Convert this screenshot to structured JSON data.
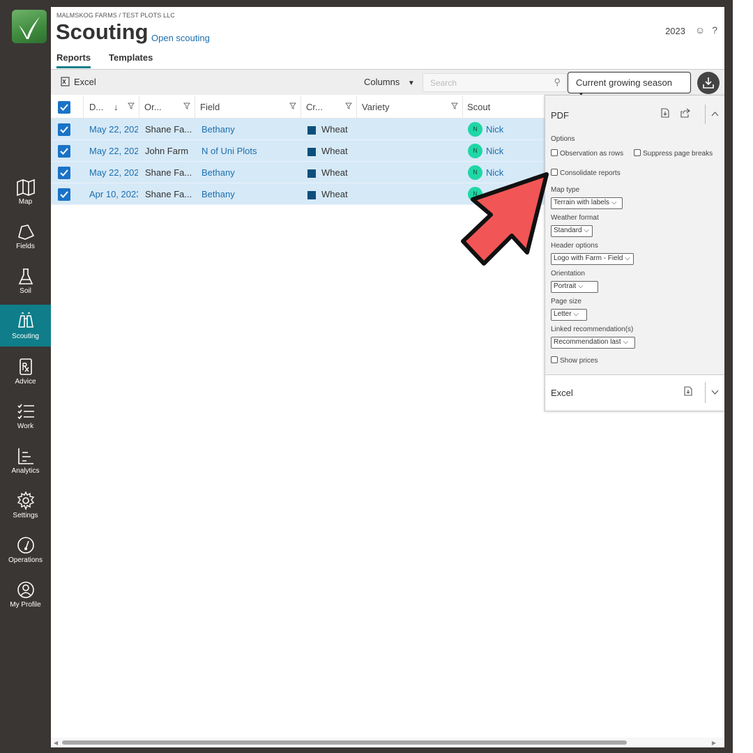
{
  "sidebar": {
    "items": [
      {
        "label": "Map",
        "icon": "map-icon"
      },
      {
        "label": "Fields",
        "icon": "fields-icon"
      },
      {
        "label": "Soil",
        "icon": "flask-icon"
      },
      {
        "label": "Scouting",
        "icon": "binoculars-icon",
        "active": true
      },
      {
        "label": "Advice",
        "icon": "prescription-icon"
      },
      {
        "label": "Work",
        "icon": "checklist-icon"
      },
      {
        "label": "Analytics",
        "icon": "analytics-icon"
      },
      {
        "label": "Settings",
        "icon": "gear-icon"
      },
      {
        "label": "Operations",
        "icon": "gauge-icon"
      },
      {
        "label": "My Profile",
        "icon": "profile-icon"
      }
    ]
  },
  "header": {
    "breadcrumb": "MALMSKOG FARMS / TEST PLOTS LLC",
    "title": "Scouting",
    "open_link": "Open scouting",
    "year": "2023",
    "tabs": [
      {
        "label": "Reports",
        "active": true
      },
      {
        "label": "Templates"
      }
    ]
  },
  "toolbar": {
    "excel_label": "Excel",
    "columns_label": "Columns",
    "search_placeholder": "Search",
    "season_label": "Current growing season"
  },
  "table": {
    "columns": [
      "D...",
      "Or...",
      "Field",
      "Cr...",
      "Variety",
      "Scout"
    ],
    "rows": [
      {
        "date": "May 22, 202",
        "org": "Shane Fa...",
        "field": "Bethany",
        "crop": "Wheat",
        "variety": "",
        "scout_initial": "N",
        "scout": "Nick"
      },
      {
        "date": "May 22, 202",
        "org": "John Farm",
        "field": "N of Uni Plots",
        "crop": "Wheat",
        "variety": "",
        "scout_initial": "N",
        "scout": "Nick"
      },
      {
        "date": "May 22, 202",
        "org": "Shane Fa...",
        "field": "Bethany",
        "crop": "Wheat",
        "variety": "",
        "scout_initial": "N",
        "scout": "Nick"
      },
      {
        "date": "Apr 10, 2023",
        "org": "Shane Fa...",
        "field": "Bethany",
        "crop": "Wheat",
        "variety": "",
        "scout_initial": "N",
        "scout": ""
      }
    ]
  },
  "export_panel": {
    "pdf_title": "PDF",
    "options_label": "Options",
    "observation_rows": "Observation as rows",
    "suppress_breaks": "Suppress page breaks",
    "consolidate": "Consolidate reports",
    "map_type_label": "Map type",
    "map_type_value": "Terrain with labels",
    "weather_label": "Weather format",
    "weather_value": "Standard",
    "header_label": "Header options",
    "header_value": "Logo with Farm - Field",
    "orientation_label": "Orientation",
    "orientation_value": "Portrait",
    "page_size_label": "Page size",
    "page_size_value": "Letter",
    "linked_label": "Linked recommendation(s)",
    "linked_value": "Recommendation last",
    "show_prices": "Show prices",
    "excel_title": "Excel"
  },
  "colors": {
    "accent": "#0f7e8a",
    "selected_row": "#d6e9f7",
    "link": "#1b6fae",
    "arrow": "#f25555"
  }
}
